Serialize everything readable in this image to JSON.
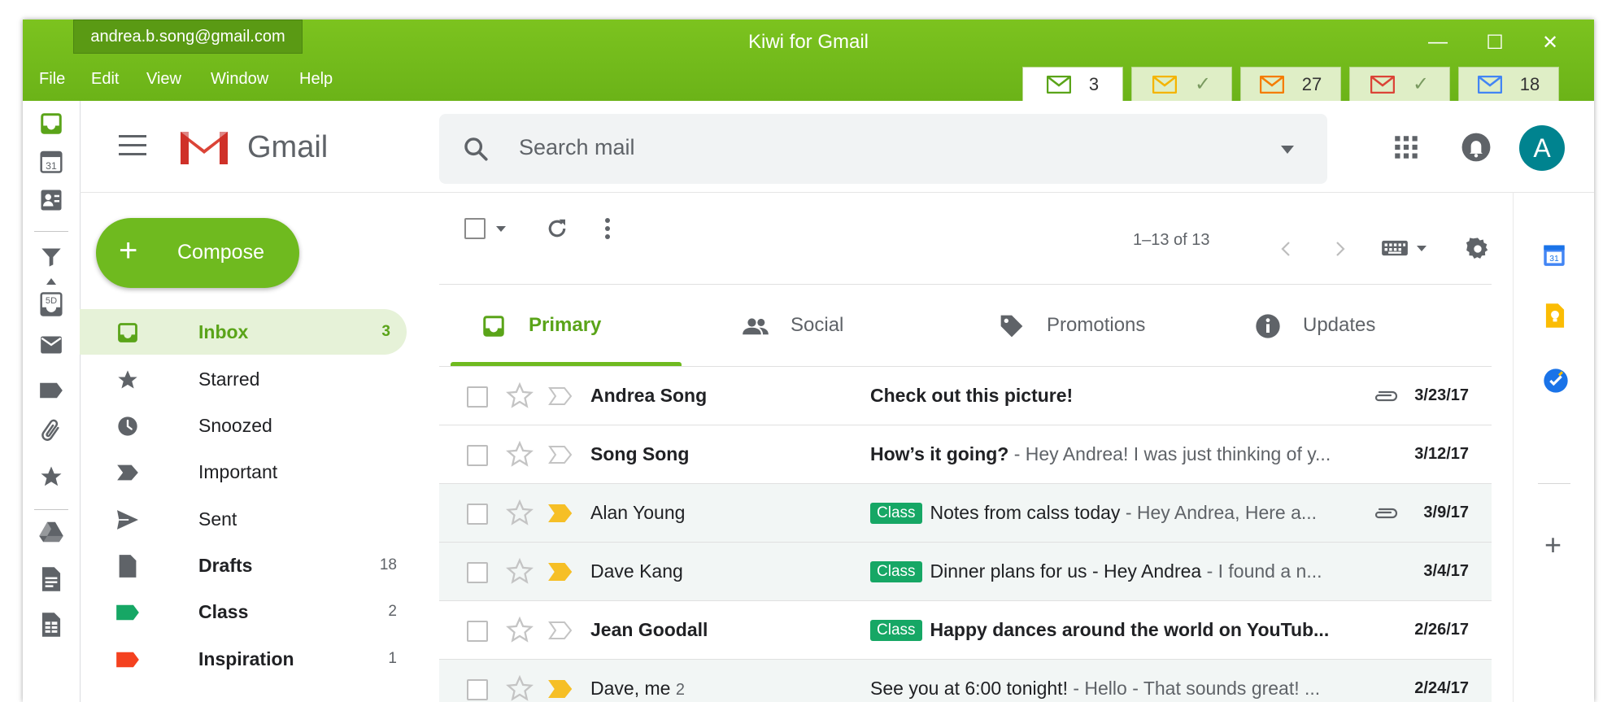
{
  "window": {
    "title": "Kiwi for Gmail",
    "account_email": "andrea.b.song@gmail.com",
    "controls": {
      "minimize": "—",
      "maximize": "☐",
      "close": "✕"
    },
    "menu": [
      "File",
      "Edit",
      "View",
      "Window",
      "Help"
    ],
    "account_tabs": [
      {
        "color": "#5aa419",
        "badge": "3",
        "active": true
      },
      {
        "color": "#f4b400",
        "badge": "✓",
        "active": false
      },
      {
        "color": "#f57c00",
        "badge": "27",
        "active": false
      },
      {
        "color": "#db4437",
        "badge": "✓",
        "active": false
      },
      {
        "color": "#4285f4",
        "badge": "18",
        "active": false
      }
    ]
  },
  "dock": {
    "items": [
      "inbox-icon",
      "calendar-icon",
      "contacts-icon",
      "filter-icon",
      "caret-up-icon",
      "snooze-5d-icon",
      "mail-icon",
      "label-icon",
      "attachment-icon",
      "star-icon",
      "drive-icon",
      "docs-icon",
      "sheets-icon"
    ],
    "calendar_day": "31",
    "snooze_label": "5D"
  },
  "header": {
    "logo_text": "Gmail",
    "search_placeholder": "Search mail",
    "avatar_letter": "A"
  },
  "compose": {
    "icon": "+",
    "label": "Compose"
  },
  "nav": [
    {
      "label": "Inbox",
      "count": "3",
      "icon": "inbox-icon",
      "active": true,
      "bold": true
    },
    {
      "label": "Starred",
      "count": "",
      "icon": "star-icon",
      "active": false,
      "bold": false
    },
    {
      "label": "Snoozed",
      "count": "",
      "icon": "clock-icon",
      "active": false,
      "bold": false
    },
    {
      "label": "Important",
      "count": "",
      "icon": "important-icon",
      "active": false,
      "bold": false
    },
    {
      "label": "Sent",
      "count": "",
      "icon": "send-icon",
      "active": false,
      "bold": false
    },
    {
      "label": "Drafts",
      "count": "18",
      "icon": "draft-icon",
      "active": false,
      "bold": true
    },
    {
      "label": "Class",
      "count": "2",
      "icon": "label-green-icon",
      "active": false,
      "bold": true
    },
    {
      "label": "Inspiration",
      "count": "1",
      "icon": "label-red-icon",
      "active": false,
      "bold": true
    }
  ],
  "toolbar": {
    "pager": "1–13 of 13"
  },
  "tabs": [
    {
      "label": "Primary",
      "active": true
    },
    {
      "label": "Social",
      "active": false
    },
    {
      "label": "Promotions",
      "active": false
    },
    {
      "label": "Updates",
      "active": false
    }
  ],
  "emails": [
    {
      "sender": "Andrea Song",
      "count": "",
      "label": "",
      "subject": "Check out this picture!",
      "snippet": "",
      "date": "3/23/17",
      "unread": true,
      "important": false,
      "attachment": true
    },
    {
      "sender": "Song Song",
      "count": "",
      "label": "",
      "subject": "How’s it going?",
      "snippet": " - Hey Andrea! I was just thinking of y...",
      "date": "3/12/17",
      "unread": true,
      "important": false,
      "attachment": false
    },
    {
      "sender": "Alan Young",
      "count": "",
      "label": "Class",
      "subject": "Notes from calss today",
      "snippet": " - Hey Andrea, Here a...",
      "date": "3/9/17",
      "unread": false,
      "important": true,
      "attachment": true
    },
    {
      "sender": "Dave Kang",
      "count": "",
      "label": "Class",
      "subject": "Dinner plans for us - Hey Andrea",
      "snippet": " - I found a n...",
      "date": "3/4/17",
      "unread": false,
      "important": true,
      "attachment": false
    },
    {
      "sender": "Jean Goodall",
      "count": "",
      "label": "Class",
      "subject": "Happy dances around the world on YouTub...",
      "snippet": "",
      "date": "2/26/17",
      "unread": true,
      "important": false,
      "attachment": false
    },
    {
      "sender": "Dave, me",
      "count": "2",
      "label": "",
      "subject": "See you at 6:00 tonight!",
      "snippet": " - Hello - That sounds great! ...",
      "date": "2/24/17",
      "unread": false,
      "important": true,
      "attachment": false
    }
  ],
  "right_panel": {
    "items": [
      "calendar-addon-icon",
      "keep-icon",
      "tasks-icon",
      "add-icon"
    ],
    "calendar_day": "31",
    "add": "+"
  }
}
